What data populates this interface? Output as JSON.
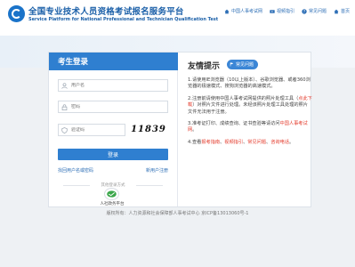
{
  "header": {
    "title_cn": "全国专业技术人员资格考试报名服务平台",
    "title_en": "Service Platform for National Professional and Technician Qualification Test",
    "links": [
      {
        "label": "中国人事考试网"
      },
      {
        "label": "视频指引"
      },
      {
        "label": "常见问题"
      },
      {
        "label": "首页"
      }
    ]
  },
  "login": {
    "title": "考生登录",
    "username_placeholder": "用户名",
    "password_placeholder": "密码",
    "captcha_placeholder": "验证码",
    "captcha_text": "11839",
    "login_button": "登录",
    "forgot_link": "找回用户名或密码",
    "register_link": "新用户注册",
    "other_methods": "其他登录方式",
    "wechat_label": "人社政务平台"
  },
  "tips": {
    "title": "友情提示",
    "faq_button": "常见问题",
    "items": [
      {
        "text": "1.请使用IE浏览器（10以上版本）、谷歌浏览器、或者360浏览器的极速模式、搜狗浏览器的高速模式。"
      },
      {
        "pre": "2.注册前请使用中国人事考试网提供的照片处理工具（",
        "hl": "点此下载",
        "post": "）对照片文件进行处理。未经该照片处理工具处理的照片文件无法用于注册。"
      },
      {
        "pre": "3.准考证打印、成绩查询、证书查验等请访问",
        "hl": "中国人事考试网",
        "post": "。"
      },
      {
        "pre": "4.查看",
        "hl1": "报考指南",
        "sep1": "、",
        "hl2": "视频指引",
        "sep2": "、",
        "hl3": "常见问题",
        "sep3": "、",
        "hl4": "咨询电话",
        "post": "。"
      }
    ]
  },
  "footer": {
    "text": "版权所有：人力资源和社会保障部人事考试中心 京ICP备13013060号-1"
  },
  "colors": {
    "brand_blue": "#2f7fd0",
    "highlight_red": "#e43b2c"
  }
}
